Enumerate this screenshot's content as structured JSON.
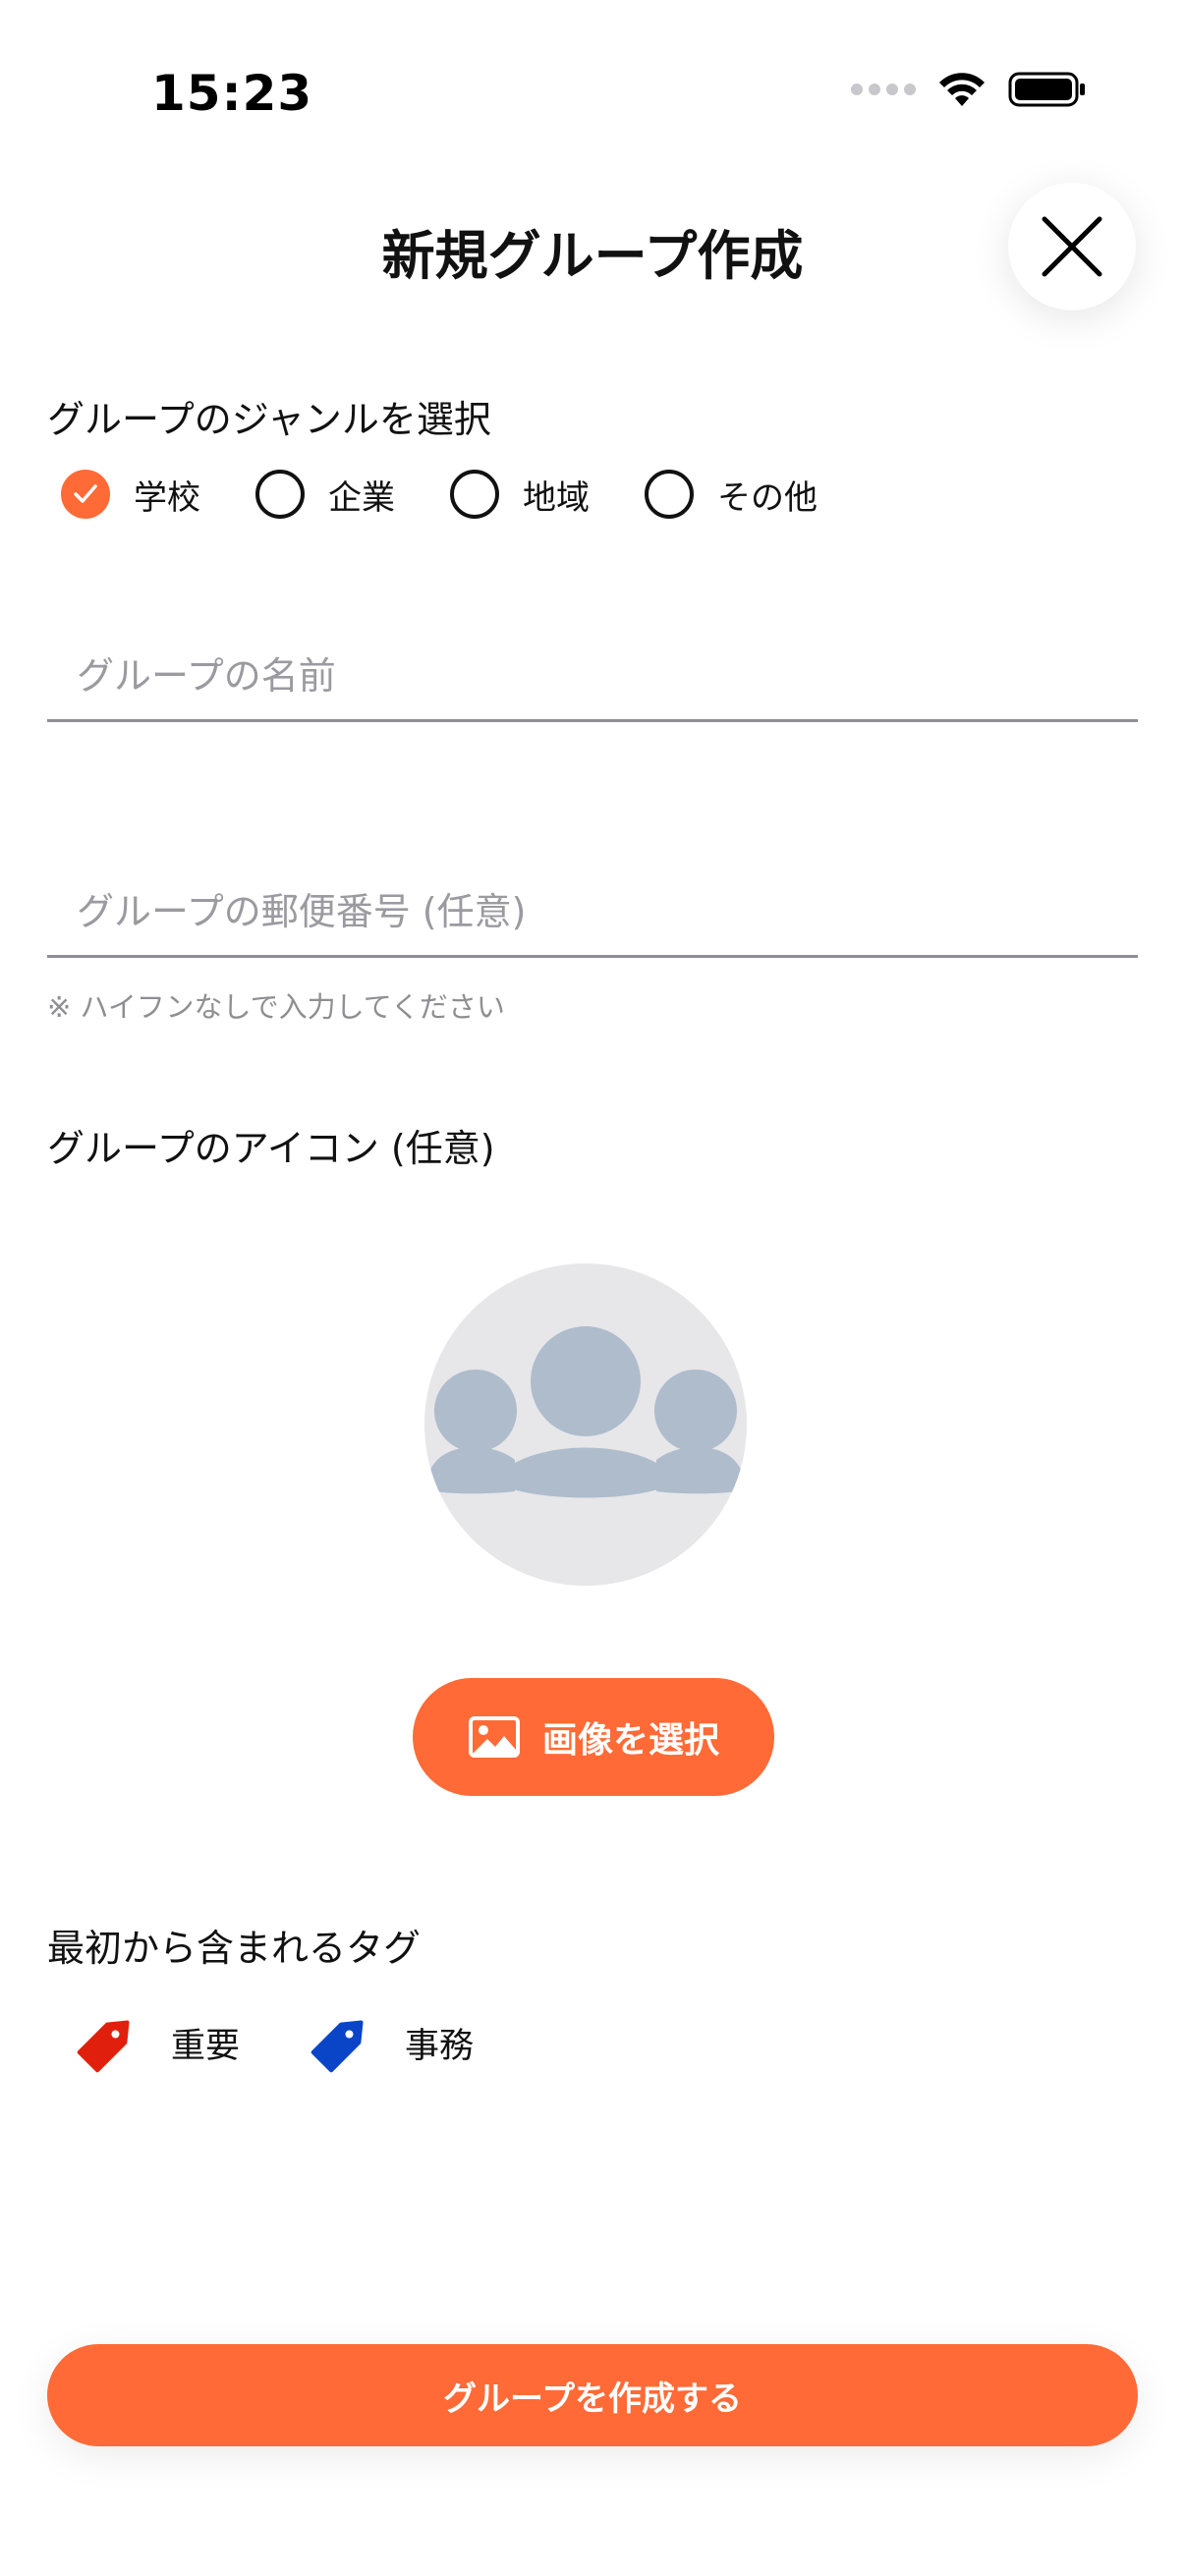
{
  "status": {
    "time": "15:23"
  },
  "header": {
    "title": "新規グループ作成"
  },
  "genre": {
    "label": "グループのジャンルを選択",
    "options": [
      "学校",
      "企業",
      "地域",
      "その他"
    ],
    "selected": "学校"
  },
  "name_field": {
    "placeholder": "グループの名前",
    "value": ""
  },
  "postal_field": {
    "placeholder": "グループの郵便番号 (任意)",
    "value": "",
    "hint": "※ ハイフンなしで入力してください"
  },
  "icon_section": {
    "label": "グループのアイコン (任意)",
    "select_button": "画像を選択"
  },
  "tags_section": {
    "label": "最初から含まれるタグ",
    "tags": [
      {
        "label": "重要",
        "color": "#e0200c"
      },
      {
        "label": "事務",
        "color": "#0a45c8"
      }
    ]
  },
  "submit_button": "グループを作成する",
  "colors": {
    "accent": "#ff6a36",
    "avatar_bg": "#e7e6e9",
    "avatar_fg": "#aebccc"
  },
  "icons": [
    "close-icon",
    "checkmark-icon",
    "image-icon",
    "tag-icon",
    "group-avatar-icon",
    "wifi-icon",
    "battery-icon"
  ]
}
